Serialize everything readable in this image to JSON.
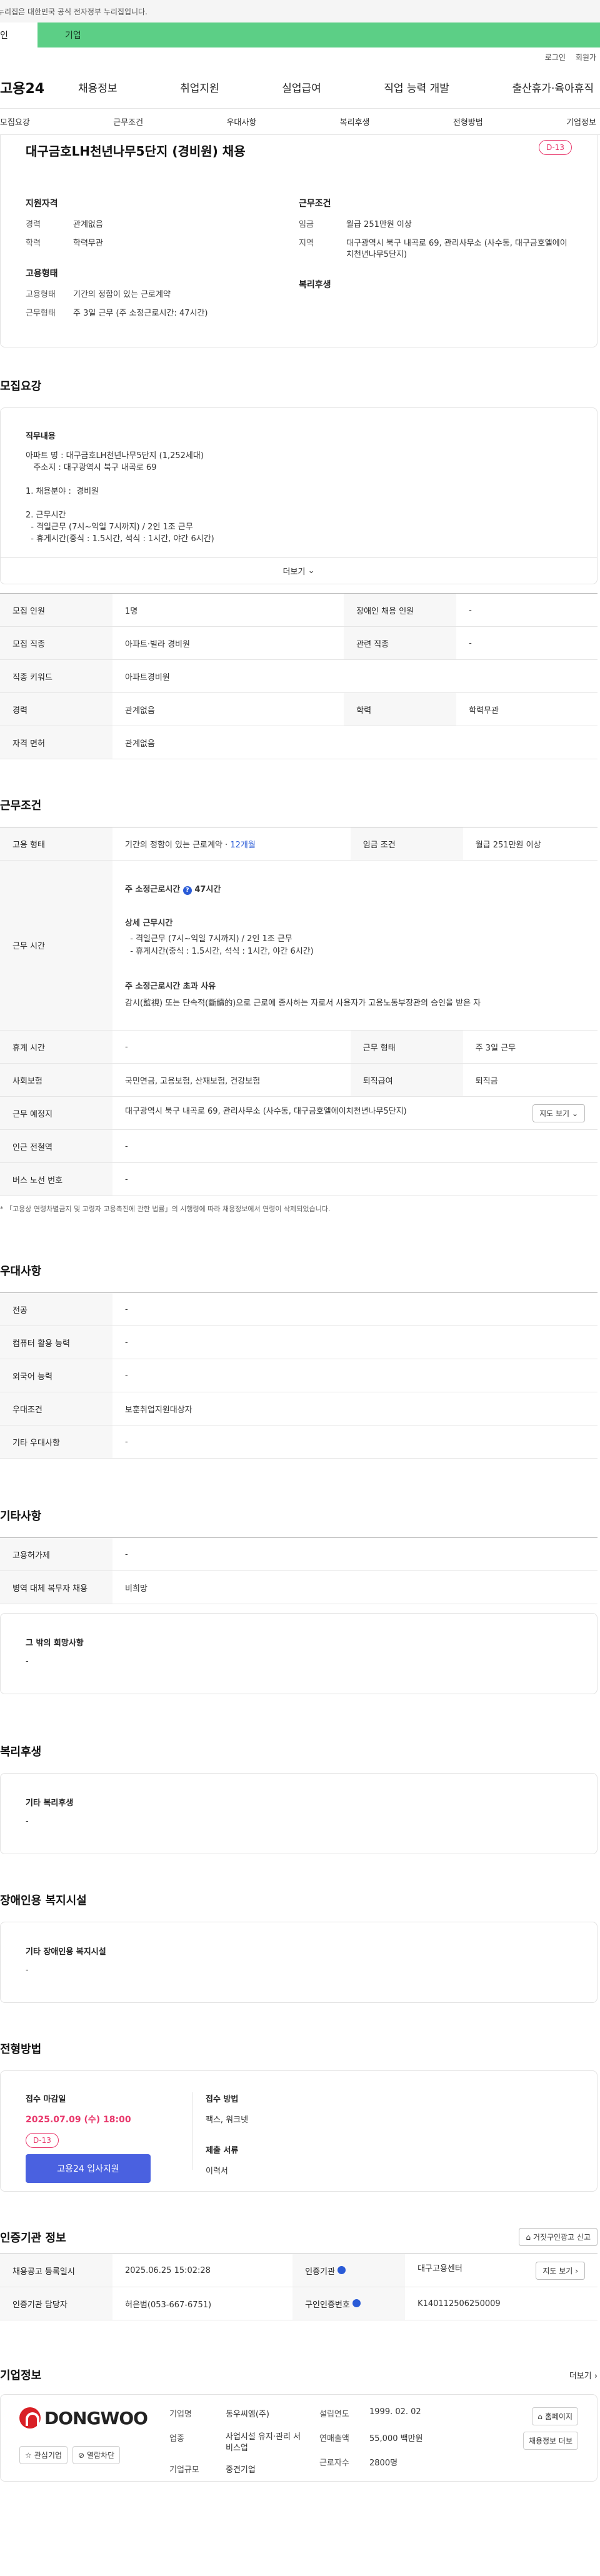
{
  "gov_strip": "누리집은 대한민국 공식 전자정부 누리집입니다.",
  "top_tabs": {
    "person": "인",
    "company": "기업"
  },
  "util": {
    "login": "로그인",
    "join": "회원가"
  },
  "gnb": {
    "logo": "고용24",
    "menu": [
      "채용정보",
      "취업지원",
      "실업급여",
      "직업 능력 개발",
      "출산휴가·육아휴직"
    ]
  },
  "anchors": [
    "모집요강",
    "근무조건",
    "우대사항",
    "복리후생",
    "전형방법",
    "기업정보"
  ],
  "summary": {
    "title": "대구금호LH천년나무5단지 (경비원) 채용",
    "dday": "D-13",
    "qual_head": "지원자격",
    "career_k": "경력",
    "career_v": "관계없음",
    "edu_k": "학력",
    "edu_v": "학력무관",
    "emp_head": "고용형태",
    "emp_k": "고용형태",
    "emp_v": "기간의 정함이 있는 근로계약",
    "work_k": "근무형태",
    "work_v": "주 3일 근무 (주 소정근로시간: 47시간)",
    "cond_head": "근무조건",
    "wage_k": "임금",
    "wage_v": "월급 251만원 이상",
    "loc_k": "지역",
    "loc_v": "대구광역시 북구 내곡로 69, 관리사무소 (사수동, 대구금호엘에이치천년나무5단지)",
    "welfare_head": "복리후생"
  },
  "recruit": {
    "section": "모집요강",
    "job_head": "직무내용",
    "lines": [
      "아파트 명 : 대구금호LH천년나무5단지 (1,252세대)",
      "   주소지 : 대구광역시 북구 내곡로 69",
      "",
      "1. 채용분야 :  경비원",
      "",
      "2. 근무시간",
      "  - 격일근무 (7시~익일 7시까지) / 2인 1조 근무",
      "  - 휴게시간(중식 : 1.5시간, 석식 : 1시간, 야간 6시간)"
    ],
    "more": "더보기"
  },
  "recruit_table": {
    "r1": [
      "모집 인원",
      "1명",
      "장애인 채용 인원",
      "-"
    ],
    "r2": [
      "모집 직종",
      "아파트·빌라 경비원",
      "관련 직종",
      "-"
    ],
    "r3": [
      "직종 키워드",
      "아파트경비원"
    ],
    "r4": [
      "경력",
      "관계없음",
      "학력",
      "학력무관"
    ],
    "r5": [
      "자격 면허",
      "관계없음"
    ]
  },
  "work": {
    "section": "근무조건",
    "emp_k": "고용 형태",
    "emp_v": "기간의 정함이 있는 근로계약 · ",
    "emp_v2": "12개월",
    "wage_k": "임금 조건",
    "wage_v": "월급 251만원 이상",
    "time_k": "근무 시간",
    "time_title": "주 소정근로시간",
    "time_hours": "47시간",
    "detail_head": "상세 근무시간",
    "detail_l1": "  - 격일근무 (7시~익일 7시까지) / 2인 1조 근무",
    "detail_l2": "  - 휴게시간(중식 : 1.5시간, 석식 : 1시간, 야간 6시간)",
    "over_head": "주 소정근로시간 초과 사유",
    "over_text": "감시(監視) 또는 단속적(斷續的)으로 근로에 종사하는 자로서 사용자가 고용노동부장관의 승인을 받은 자",
    "rest_k": "휴게 시간",
    "rest_v": "-",
    "form_k": "근무 형태",
    "form_v": "주 3일 근무",
    "ins_k": "사회보험",
    "ins_v": "국민연금, 고용보험, 산재보험, 건강보험",
    "ret_k": "퇴직급여",
    "ret_v": "퇴직금",
    "place_k": "근무 예정지",
    "place_v": "대구광역시 북구 내곡로 69, 관리사무소 (사수동, 대구금호엘에이치천년나무5단지)",
    "map_btn": "지도 보기",
    "sub_k": "인근 전철역",
    "sub_v": "-",
    "bus_k": "버스 노선 번호",
    "bus_v": "-",
    "note": "* 「고용상 연령차별금지 및 고령자 고용촉진에 관한 법률」의 시행령에 따라 채용정보에서 연령이 삭제되었습니다."
  },
  "pref": {
    "section": "우대사항",
    "rows": [
      [
        "전공",
        "-"
      ],
      [
        "컴퓨터 활용 능력",
        "-"
      ],
      [
        "외국어 능력",
        "-"
      ],
      [
        "우대조건",
        "보훈취업지원대상자"
      ],
      [
        "기타 우대사항",
        "-"
      ]
    ]
  },
  "etc": {
    "section": "기타사항",
    "rows": [
      [
        "고용허가제",
        "-"
      ],
      [
        "병역 대체 복무자 채용",
        "비희망"
      ]
    ],
    "box_head": "그 밖의 희망사항",
    "box_val": "-"
  },
  "welfare": {
    "section": "복리후생",
    "head": "기타 복리후생",
    "val": "-"
  },
  "disabled": {
    "section": "장애인용 복지시설",
    "head": "기타 장애인용 복지시설",
    "val": "-"
  },
  "process": {
    "section": "전형방법",
    "deadline_lbl": "접수 마감일",
    "deadline": "2025.07.09 (수) 18:00",
    "dday": "D-13",
    "apply": "고용24 입사지원",
    "method_lbl": "접수 방법",
    "method": "팩스, 워크넷",
    "docs_lbl": "제출 서류",
    "docs": "이력서"
  },
  "auth": {
    "section": "인증기관 정보",
    "report_btn": "거짓구인광고 신고",
    "r1": [
      "채용공고 등록일시",
      "2025.06.25 15:02:28",
      "인증기관",
      "대구고용센터"
    ],
    "map_btn": "지도 보기",
    "r2": [
      "인증기관 담당자",
      "허은범(053-667-6751)",
      "구인인증번호",
      "K140112506250009"
    ]
  },
  "company": {
    "section": "기업정보",
    "more": "더보기",
    "logo_text": "DONGWOO",
    "fav": "관심기업",
    "block": "열람차단",
    "name_k": "기업명",
    "name_v": "동우씨엠(주)",
    "ind_k": "업종",
    "ind_v": "사업시설 유지·관리 서비스업",
    "size_k": "기업규모",
    "size_v": "중견기업",
    "est_k": "설립연도",
    "est_v": "1999. 02. 02",
    "sales_k": "연매출액",
    "sales_v": "55,000 백만원",
    "emp_k": "근로자수",
    "emp_v": "2800명",
    "home_btn": "홈페이지",
    "more_btn": "채용정보 더보"
  },
  "colors": {
    "accent": "#4a61e0",
    "dday": "#e8376b",
    "company_tab": "#5ccf86"
  }
}
